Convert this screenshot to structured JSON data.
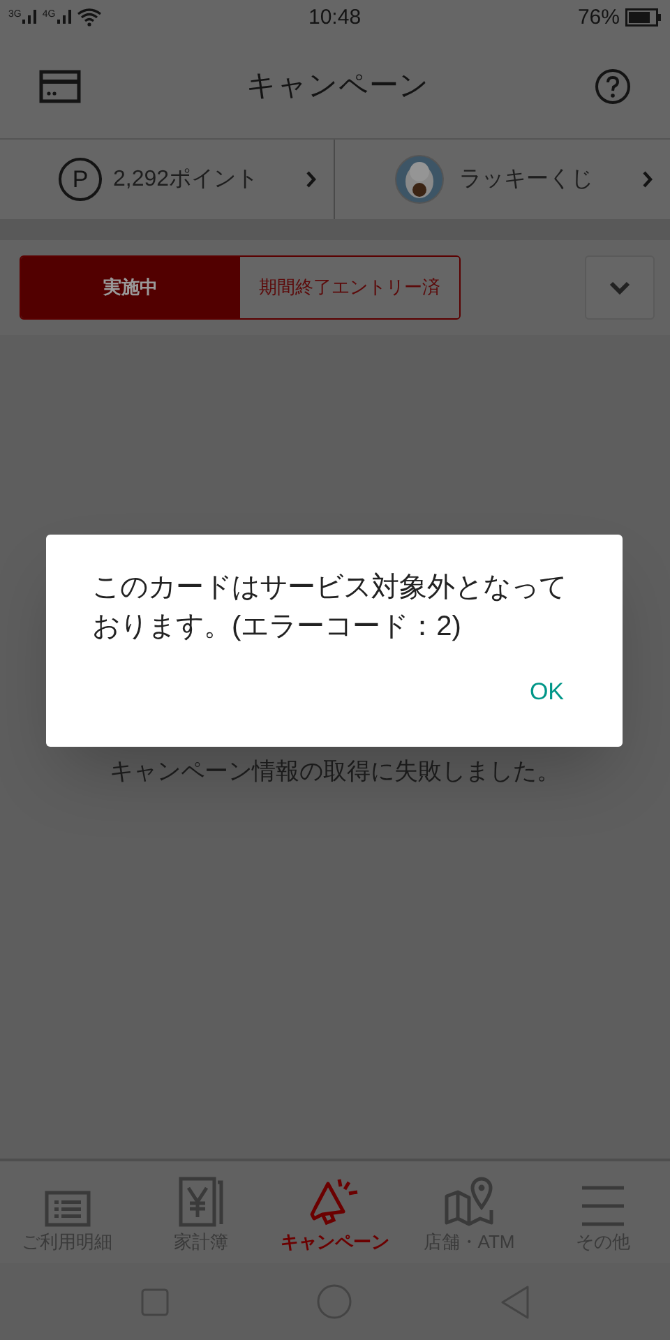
{
  "status_bar": {
    "networks": [
      "3G",
      "4G"
    ],
    "time": "10:48",
    "battery": "76%"
  },
  "header": {
    "title": "キャンペーン"
  },
  "summary": {
    "points": "2,292ポイント",
    "points_symbol": "P",
    "lottery": "ラッキーくじ"
  },
  "tabs": [
    {
      "label": "実施中",
      "selected": true
    },
    {
      "label": "期間終了エントリー済",
      "selected": false
    }
  ],
  "message": "キャンペーン情報の取得に失敗しました。",
  "dialog": {
    "message": "このカードはサービス対象外となっております。(エラーコード：2)",
    "button": "OK"
  },
  "nav": [
    {
      "kind": "statement",
      "label": "ご利用明細",
      "selected": false
    },
    {
      "kind": "ledger",
      "label": "家計簿",
      "selected": false
    },
    {
      "kind": "campaign",
      "label": "キャンペーン",
      "selected": true
    },
    {
      "kind": "map",
      "label": "店舗・ATM",
      "selected": false
    },
    {
      "kind": "menu",
      "label": "その他",
      "selected": false
    }
  ]
}
